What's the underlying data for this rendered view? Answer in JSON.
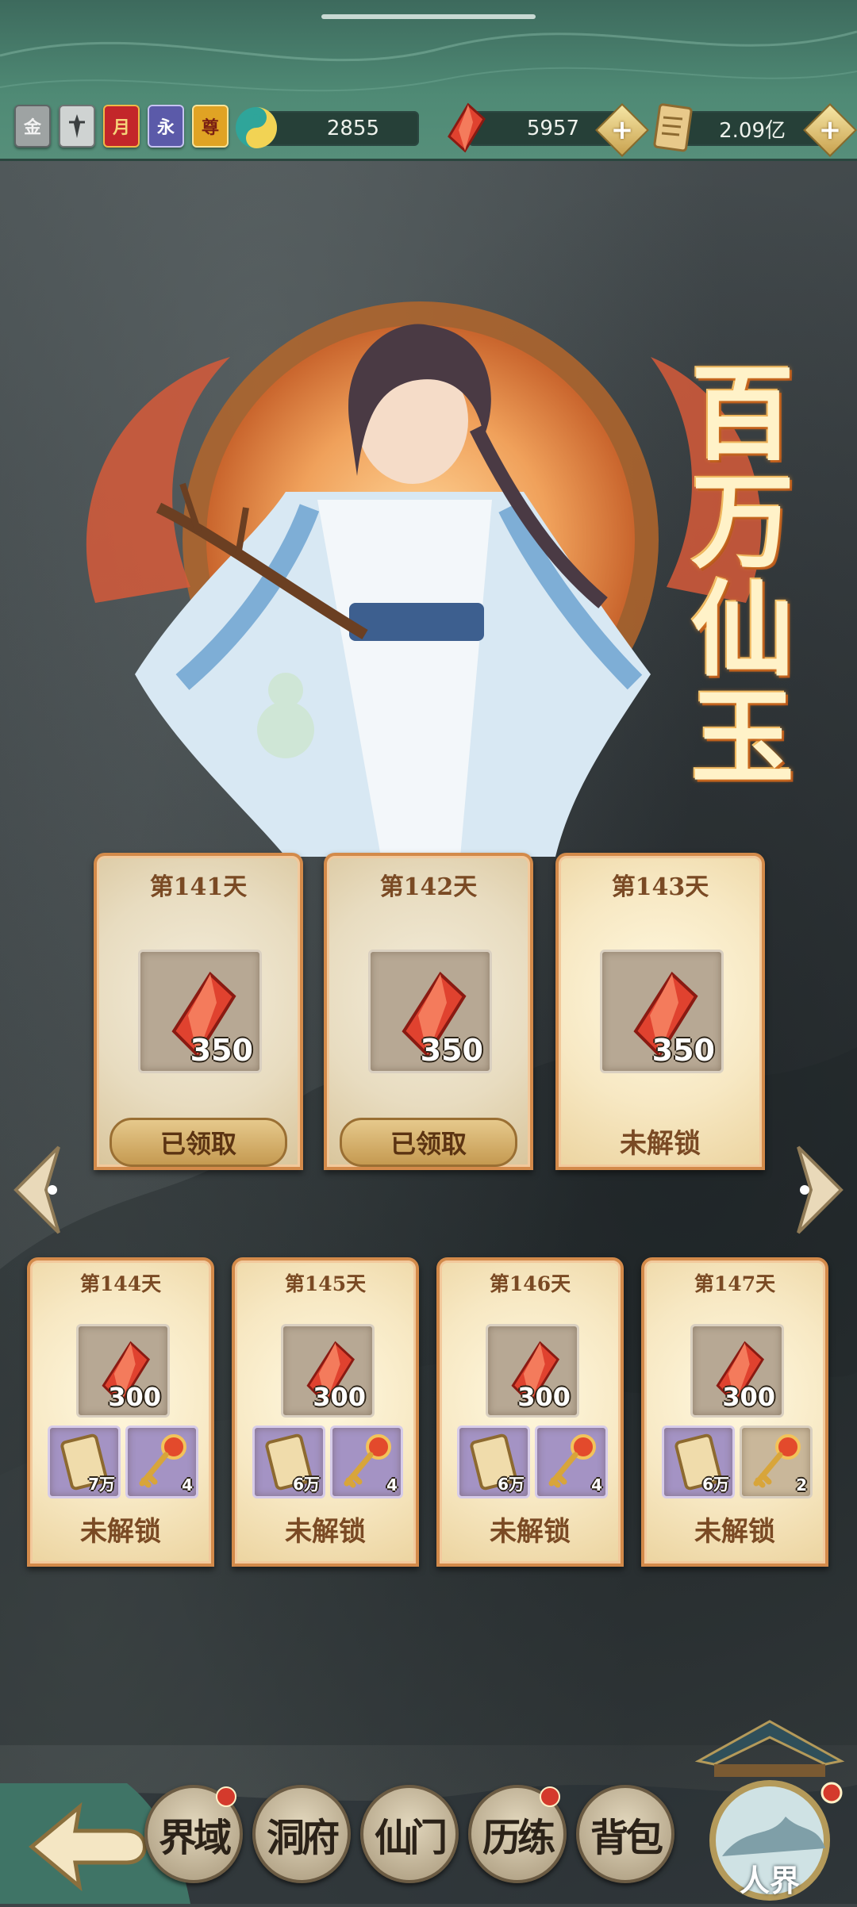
{
  "topbar": {
    "badges": [
      "金",
      "",
      "月",
      "永",
      "尊"
    ],
    "resources": [
      {
        "icon": "jade-swirl-icon",
        "value": "2855"
      },
      {
        "icon": "red-crystal-icon",
        "value": "5957"
      },
      {
        "icon": "scroll-icon",
        "value": "2.09亿"
      }
    ]
  },
  "hero": {
    "title": "百万仙玉"
  },
  "top_rewards": [
    {
      "day": "第141天",
      "amount": "350",
      "status": "已领取",
      "claimed": true
    },
    {
      "day": "第142天",
      "amount": "350",
      "status": "已领取",
      "claimed": true
    },
    {
      "day": "第143天",
      "amount": "350",
      "status": "未解锁",
      "claimed": false
    }
  ],
  "bottom_rewards": [
    {
      "day": "第144天",
      "amount": "300",
      "scroll_qty": "7万",
      "key_qty": "4",
      "status": "未解锁"
    },
    {
      "day": "第145天",
      "amount": "300",
      "scroll_qty": "6万",
      "key_qty": "4",
      "status": "未解锁"
    },
    {
      "day": "第146天",
      "amount": "300",
      "scroll_qty": "6万",
      "key_qty": "4",
      "status": "未解锁"
    },
    {
      "day": "第147天",
      "amount": "300",
      "scroll_qty": "6万",
      "key_qty": "2",
      "status": "未解锁"
    }
  ],
  "nav": {
    "items": [
      {
        "label": "界域",
        "dot": true
      },
      {
        "label": "洞府",
        "dot": false
      },
      {
        "label": "仙门",
        "dot": false
      },
      {
        "label": "历练",
        "dot": true
      },
      {
        "label": "背包",
        "dot": false
      }
    ],
    "realm_label": "人界"
  },
  "colors": {
    "accent": "#d38a4a",
    "topbar": "#4f8a75",
    "card_bg": "#f7e8c3",
    "crystal": "#e0422f"
  }
}
